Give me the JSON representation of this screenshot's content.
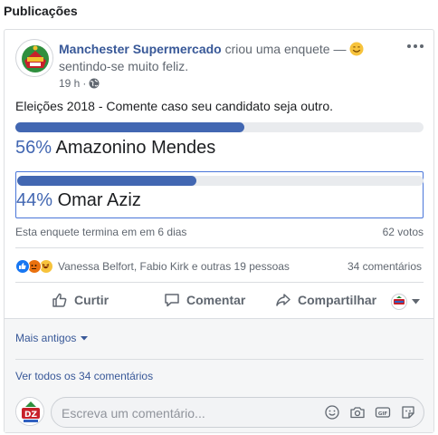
{
  "section": {
    "title": "Publicações"
  },
  "post": {
    "page_name": "Manchester Supermercado",
    "action_text": " criou uma enquete — ",
    "feeling_text": "sentindo-se muito feliz.",
    "time": "19 h",
    "audience_icon": "globe-icon",
    "text": "Eleições 2018 - Comente caso seu candidato seja outro."
  },
  "poll": {
    "options": [
      {
        "percent_label": "56%",
        "percent": 56,
        "label": "Amazonino Mendes",
        "selected": false
      },
      {
        "percent_label": "44%",
        "percent": 44,
        "label": "Omar Aziz",
        "selected": true
      }
    ],
    "footer_text": "Esta enquete termina em em 6 dias",
    "votes": "62 votos"
  },
  "reactions": {
    "names": "Vanessa Belfort, Fabio Kirk e outras 19 pessoas",
    "comments_count": "34 comentários",
    "icons": [
      "like-icon",
      "angry-icon",
      "haha-icon"
    ]
  },
  "actions": {
    "like": "Curtir",
    "comment": "Comentar",
    "share": "Compartilhar"
  },
  "comments": {
    "more_label": "Mais antigos",
    "view_all": "Ver todos os 34 comentários",
    "input_placeholder": "Escreva um comentário..."
  },
  "colors": {
    "brand_blue": "#4267b2",
    "link_blue": "#385898",
    "muted": "#606770"
  }
}
